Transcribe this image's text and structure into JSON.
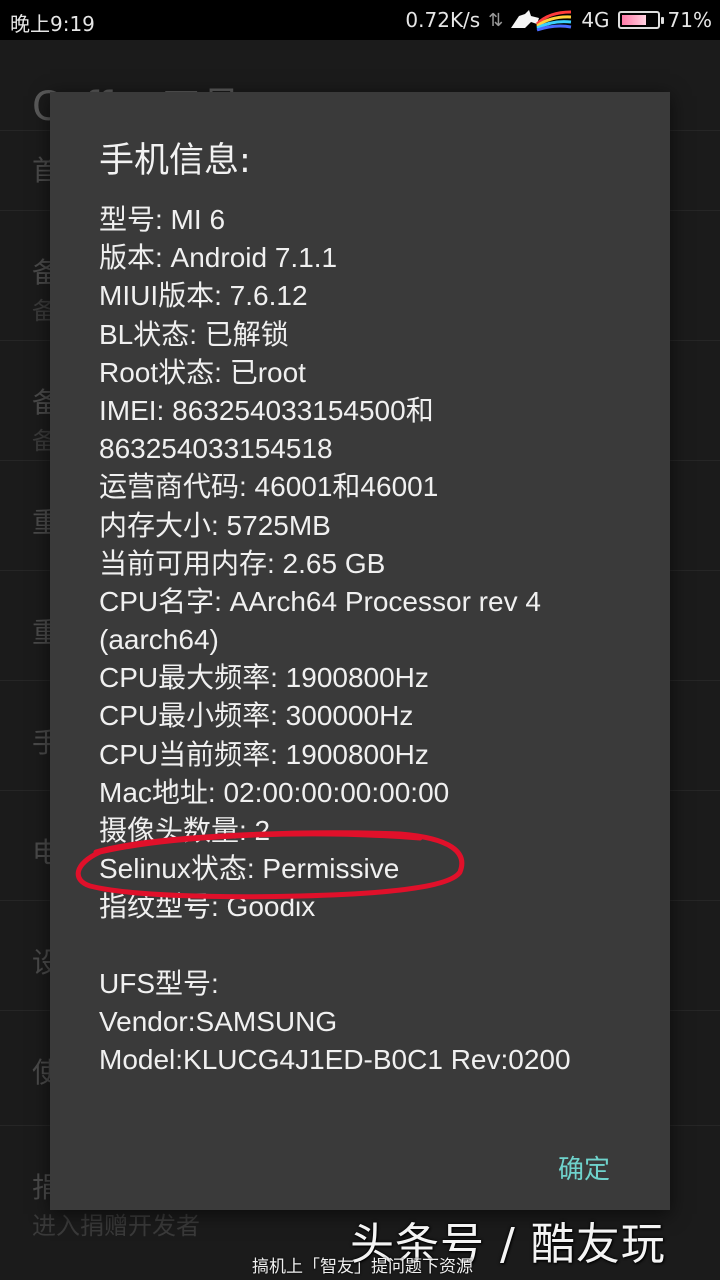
{
  "status_bar": {
    "time": "晚上9:19",
    "speed": "0.72K/s",
    "network": "4G",
    "battery": "71%",
    "battery_level": 0.71,
    "icons": [
      "data-arrows-icon",
      "horse-logo-icon",
      "battery-icon"
    ]
  },
  "background_app": {
    "title": "Coffee工具",
    "rows": [
      {
        "label": "首",
        "sub": ""
      },
      {
        "label": "备",
        "sub": "备"
      },
      {
        "label": "备",
        "sub": "备"
      },
      {
        "label": "重",
        "sub": ""
      },
      {
        "label": "重",
        "sub": ""
      },
      {
        "label": "手",
        "sub": ""
      },
      {
        "label": "电",
        "sub": ""
      },
      {
        "label": "设",
        "sub": ""
      },
      {
        "label": "使",
        "sub": ""
      },
      {
        "label": "捐赠开发者",
        "sub": "进入捐赠开发者"
      }
    ]
  },
  "dialog": {
    "title": "手机信息:",
    "lines": [
      "型号: MI 6",
      "版本: Android 7.1.1",
      "MIUI版本: 7.6.12",
      "BL状态: 已解锁",
      "Root状态: 已root",
      "IMEI: 863254033154500和",
      "863254033154518",
      "运营商代码: 46001和46001",
      "内存大小: 5725MB",
      "当前可用内存: 2.65 GB",
      "CPU名字: AArch64 Processor rev 4",
      "(aarch64)",
      "CPU最大频率: 1900800Hz",
      "CPU最小频率: 300000Hz",
      "CPU当前频率: 1900800Hz",
      "Mac地址: 02:00:00:00:00:00",
      "摄像头数量: 2",
      "Selinux状态: Permissive",
      "指纹型号: Goodix",
      "",
      "UFS型号:",
      "Vendor:SAMSUNG",
      "Model:KLUCG4J1ED-B0C1 Rev:0200"
    ],
    "confirm_label": "确定"
  },
  "watermark": {
    "main": "头条号 / 酷友玩",
    "sub": "搞机上「智友」提问题下资源"
  },
  "colors": {
    "dialog_bg": "#3a3a3a",
    "accent": "#6fd3cc",
    "annotation": "#e0102a"
  }
}
